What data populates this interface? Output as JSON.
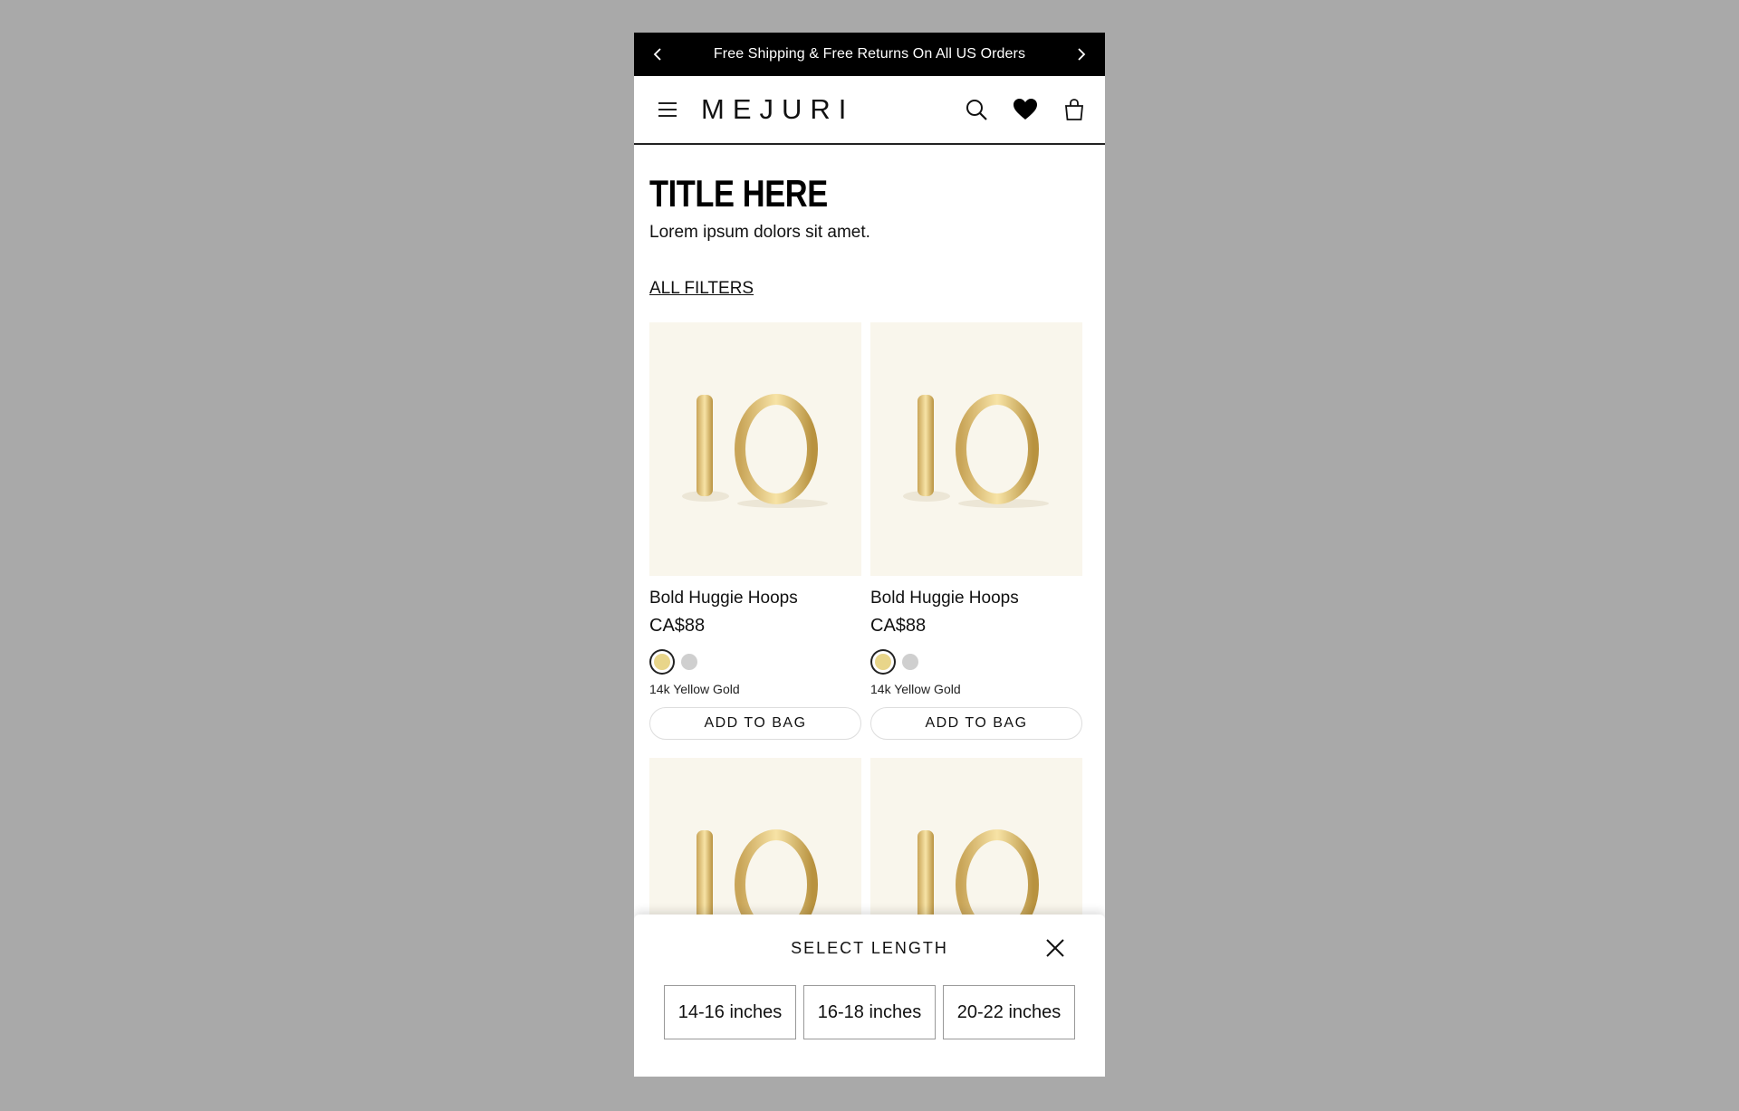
{
  "promo": {
    "message": "Free Shipping & Free Returns On All US Orders"
  },
  "header": {
    "logo": "MEJURI",
    "icons": [
      "menu-icon",
      "search-icon",
      "heart-icon",
      "bag-icon"
    ]
  },
  "page": {
    "title": "TITLE HERE",
    "subtitle": "Lorem ipsum dolors sit amet.",
    "filters_label": "ALL FILTERS"
  },
  "products": [
    {
      "name": "Bold Huggie Hoops",
      "price": "CA$88",
      "metal": "14k Yellow Gold",
      "cta": "ADD TO BAG"
    },
    {
      "name": "Bold Huggie Hoops",
      "price": "CA$88",
      "metal": "14k Yellow Gold",
      "cta": "ADD TO BAG"
    }
  ],
  "swatch_colors": {
    "gold": "#e8d58a",
    "silver": "#cfcfcf"
  },
  "sheet": {
    "title": "SELECT LENGTH",
    "options": [
      "14-16 inches",
      "16-18 inches",
      "20-22 inches"
    ]
  }
}
